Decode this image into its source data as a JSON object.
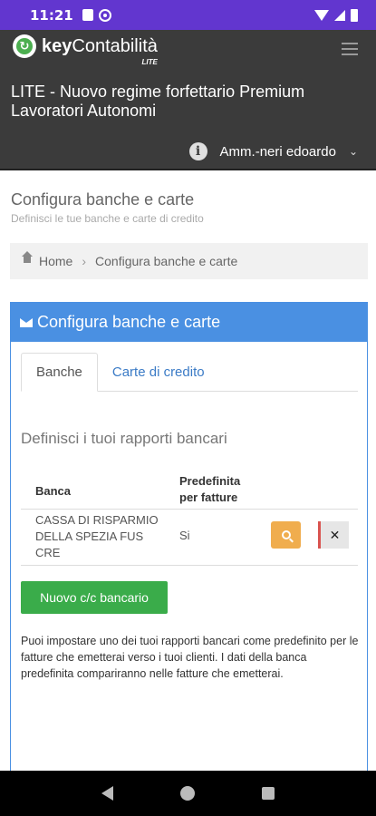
{
  "status_bar": {
    "time": "11:21"
  },
  "app": {
    "logo_text_bold": "key",
    "logo_text_regular": "Contabilità",
    "logo_sub": "LITE",
    "logo_glyph": "↻",
    "subscription": "LITE - Nuovo regime forfettario Premium Lavoratori Autonomi",
    "info_glyph": "i",
    "user_name": "Amm.-neri edoardo",
    "user_chevron": "⌄"
  },
  "page": {
    "title": "Configura banche e carte",
    "subtitle": "Definisci le tue banche e carte di credito"
  },
  "breadcrumb": {
    "home": "Home",
    "separator": "›",
    "current": "Configura banche e carte"
  },
  "panel": {
    "title": "Configura banche e carte",
    "tabs": [
      {
        "label": "Banche",
        "active": true
      },
      {
        "label": "Carte di credito",
        "active": false
      }
    ],
    "section_title": "Definisci i tuoi rapporti bancari",
    "table": {
      "columns": [
        "Banca",
        "Predefinita per fatture"
      ],
      "rows": [
        {
          "banca": "CASSA DI RISPARMIO DELLA SPEZIA FUS CRE",
          "predefinita": "Si",
          "delete_label": "✕"
        }
      ]
    },
    "new_button": "Nuovo c/c bancario",
    "help_text": "Puoi impostare uno dei tuoi rapporti bancari come predefinito per le fatture che emetterai verso i tuoi clienti. I dati della banca predefinita compariranno nelle fatture che emetterai."
  },
  "colors": {
    "status_bar": "#6236cf",
    "header": "#3b3b3b",
    "panel_header": "#4a90e2",
    "search_button": "#f0ad4e",
    "new_button": "#3aac4a",
    "delete_accent": "#d9534f"
  }
}
